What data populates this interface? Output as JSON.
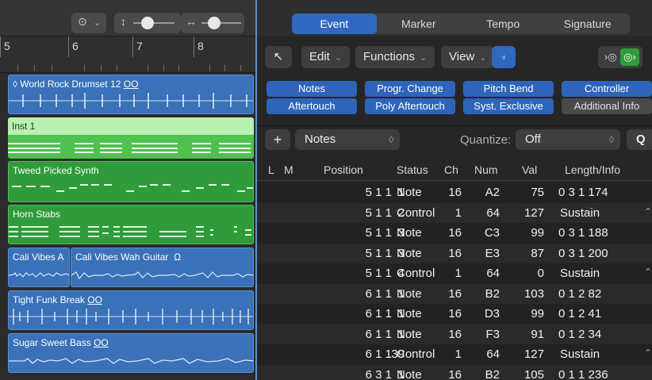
{
  "tracks_toolbar": {
    "more_icon": "ellipsis-circle-icon",
    "chevron": "⌄",
    "vzoom_icon": "↕",
    "hzoom_icon": "↔"
  },
  "ruler": {
    "bars": [
      "5",
      "6",
      "7",
      "8"
    ]
  },
  "regions": [
    {
      "name": "World Rock Drumset 12",
      "suffix": "OO",
      "color": "blue"
    },
    {
      "name": "Inst 1",
      "color": "lightgreen"
    },
    {
      "name": "Tweed Picked Synth",
      "color": "green"
    },
    {
      "name": "Horn Stabs",
      "color": "green"
    },
    {
      "name": "Cali Vibes A",
      "name2": "Cali Vibes Wah Guitar",
      "suffix2": "Ω",
      "color": "blue"
    },
    {
      "name": "Tight Funk Break",
      "suffix": "OO",
      "color": "blue"
    },
    {
      "name": "Sugar Sweet Bass",
      "suffix": "OO",
      "color": "blue"
    }
  ],
  "event_list": {
    "tabs": [
      "Event",
      "Marker",
      "Tempo",
      "Signature"
    ],
    "active_tab": "Event",
    "toolbar": {
      "back_icon": "↖",
      "edit": "Edit",
      "functions": "Functions",
      "view": "View",
      "midi_in_icon": "midi-in-icon",
      "chev": "⌄"
    },
    "filters": [
      {
        "label": "Notes",
        "on": true
      },
      {
        "label": "Progr. Change",
        "on": true
      },
      {
        "label": "Pitch Bend",
        "on": true
      },
      {
        "label": "Controller",
        "on": true
      },
      {
        "label": "Aftertouch",
        "on": true
      },
      {
        "label": "Poly Aftertouch",
        "on": true
      },
      {
        "label": "Syst. Exclusive",
        "on": true
      },
      {
        "label": "Additional Info",
        "on": false
      }
    ],
    "create": {
      "plus": "+",
      "type": "Notes",
      "quantize_label": "Quantize:",
      "quantize_value": "Off",
      "q": "Q"
    },
    "columns": {
      "l": "L",
      "m": "M",
      "position": "Position",
      "status": "Status",
      "ch": "Ch",
      "num": "Num",
      "val": "Val",
      "length": "Length/Info"
    },
    "rows": [
      {
        "pos": "5 1 1",
        "tick": "1",
        "status": "Note",
        "ch": "16",
        "num": "A2",
        "val": "75",
        "len": "0 3 1 174"
      },
      {
        "pos": "5 1 1",
        "tick": "2",
        "status": "Control",
        "ch": "1",
        "num": "64",
        "val": "127",
        "info": "Sustain"
      },
      {
        "pos": "5 1 1",
        "tick": "3",
        "status": "Note",
        "ch": "16",
        "num": "C3",
        "val": "99",
        "len": "0 3 1 188"
      },
      {
        "pos": "5 1 1",
        "tick": "3",
        "status": "Note",
        "ch": "16",
        "num": "E3",
        "val": "87",
        "len": "0 3 1 200"
      },
      {
        "pos": "5 1 1",
        "tick": "4",
        "status": "Control",
        "ch": "1",
        "num": "64",
        "val": "0",
        "info": "Sustain"
      },
      {
        "pos": "6 1 1",
        "tick": "1",
        "status": "Note",
        "ch": "16",
        "num": "B2",
        "val": "103",
        "len": "0 1 2 82"
      },
      {
        "pos": "6 1 1",
        "tick": "1",
        "status": "Note",
        "ch": "16",
        "num": "D3",
        "val": "99",
        "len": "0 1 2 41"
      },
      {
        "pos": "6 1 1",
        "tick": "1",
        "status": "Note",
        "ch": "16",
        "num": "F3",
        "val": "91",
        "len": "0 1 2 34"
      },
      {
        "pos": "6 1 1",
        "tick": "39",
        "status": "Control",
        "ch": "1",
        "num": "64",
        "val": "127",
        "info": "Sustain"
      },
      {
        "pos": "6 3 1",
        "tick": "1",
        "status": "Note",
        "ch": "16",
        "num": "B2",
        "val": "105",
        "len": "0 1 1 236"
      }
    ]
  }
}
